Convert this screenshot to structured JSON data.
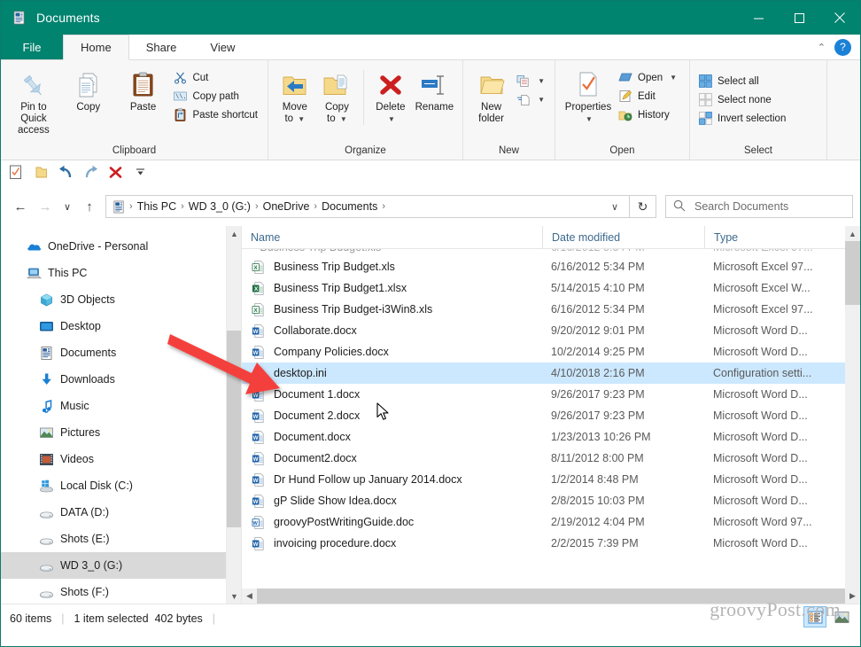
{
  "window": {
    "title": "Documents",
    "title_icon": "documents-folder-icon",
    "minimize_label": "─",
    "maximize_label": "☐",
    "close_label": "✕"
  },
  "tabs": {
    "file_label": "File",
    "items": [
      {
        "label": "Home",
        "active": true
      },
      {
        "label": "Share",
        "active": false
      },
      {
        "label": "View",
        "active": false
      }
    ],
    "collapse_label": "⌃",
    "help_label": "?"
  },
  "ribbon": {
    "groups": [
      {
        "label": "Clipboard",
        "big_buttons": [
          {
            "label": "Pin to Quick\naccess",
            "icon": "pin-icon",
            "line1": "Pin to Quick",
            "line2": "access"
          },
          {
            "label": "Copy",
            "icon": "copy-icon",
            "line1": "Copy",
            "line2": ""
          },
          {
            "label": "Paste",
            "icon": "paste-icon",
            "line1": "Paste",
            "line2": ""
          }
        ],
        "small_buttons": [
          {
            "label": "Cut",
            "icon": "scissors-icon"
          },
          {
            "label": "Copy path",
            "icon": "copy-path-icon"
          },
          {
            "label": "Paste shortcut",
            "icon": "paste-shortcut-icon"
          }
        ]
      },
      {
        "label": "Organize",
        "big_buttons": [
          {
            "line1": "Move",
            "line2": "to",
            "icon": "move-to-icon",
            "dropdown": true
          },
          {
            "line1": "Copy",
            "line2": "to",
            "icon": "copy-to-icon",
            "dropdown": true
          },
          {
            "line1": "Delete",
            "line2": "",
            "icon": "delete-icon",
            "dropdown": true
          },
          {
            "line1": "Rename",
            "line2": "",
            "icon": "rename-icon",
            "dropdown": false
          }
        ],
        "small_buttons": []
      },
      {
        "label": "New",
        "big_buttons": [
          {
            "line1": "New",
            "line2": "folder",
            "icon": "new-folder-icon",
            "dropdown": false
          }
        ],
        "small_buttons": [
          {
            "label": "",
            "icon": "new-item-icon",
            "dropdown": true
          },
          {
            "label": "",
            "icon": "easy-access-icon",
            "dropdown": true
          }
        ]
      },
      {
        "label": "Open",
        "big_buttons": [
          {
            "line1": "Properties",
            "line2": "",
            "icon": "properties-icon",
            "dropdown": true
          }
        ],
        "small_buttons": [
          {
            "label": "Open",
            "icon": "open-icon",
            "dropdown": true
          },
          {
            "label": "Edit",
            "icon": "edit-icon",
            "dropdown": false
          },
          {
            "label": "History",
            "icon": "history-icon",
            "dropdown": false
          }
        ]
      },
      {
        "label": "Select",
        "big_buttons": [],
        "small_buttons": [
          {
            "label": "Select all",
            "icon": "select-all-icon"
          },
          {
            "label": "Select none",
            "icon": "select-none-icon"
          },
          {
            "label": "Invert selection",
            "icon": "invert-selection-icon"
          }
        ]
      }
    ]
  },
  "quick_access": {
    "items": [
      {
        "name": "properties-qat-icon"
      },
      {
        "name": "new-folder-qat-icon"
      },
      {
        "name": "undo-qat-icon"
      },
      {
        "name": "redo-qat-icon"
      },
      {
        "name": "delete-qat-icon"
      },
      {
        "name": "customize-qat-icon"
      }
    ]
  },
  "navigation": {
    "back_label": "←",
    "forward_label": "→",
    "recent_label": "∨",
    "up_label": "↑",
    "breadcrumb": [
      "This PC",
      "WD 3_0 (G:)",
      "OneDrive",
      "Documents"
    ],
    "breadcrumb_separator": "›",
    "dropdown_label": "∨",
    "refresh_label": "↻"
  },
  "search": {
    "placeholder": "Search Documents",
    "value": "",
    "icon": "search-icon"
  },
  "sidebar": {
    "items": [
      {
        "label": "OneDrive - Personal",
        "icon": "onedrive-icon",
        "level": 0,
        "selected": false
      },
      {
        "label": "This PC",
        "icon": "this-pc-icon",
        "level": 0,
        "selected": false
      },
      {
        "label": "3D Objects",
        "icon": "3d-objects-icon",
        "level": 1,
        "selected": false
      },
      {
        "label": "Desktop",
        "icon": "desktop-icon",
        "level": 1,
        "selected": false
      },
      {
        "label": "Documents",
        "icon": "documents-icon",
        "level": 1,
        "selected": false
      },
      {
        "label": "Downloads",
        "icon": "downloads-icon",
        "level": 1,
        "selected": false
      },
      {
        "label": "Music",
        "icon": "music-icon",
        "level": 1,
        "selected": false
      },
      {
        "label": "Pictures",
        "icon": "pictures-icon",
        "level": 1,
        "selected": false
      },
      {
        "label": "Videos",
        "icon": "videos-icon",
        "level": 1,
        "selected": false
      },
      {
        "label": "Local Disk (C:)",
        "icon": "local-disk-icon",
        "level": 1,
        "selected": false
      },
      {
        "label": "DATA (D:)",
        "icon": "drive-icon",
        "level": 1,
        "selected": false
      },
      {
        "label": "Shots (E:)",
        "icon": "drive-icon",
        "level": 1,
        "selected": false
      },
      {
        "label": "WD 3_0 (G:)",
        "icon": "drive-icon",
        "level": 1,
        "selected": true
      },
      {
        "label": "Shots (F:)",
        "icon": "drive-icon",
        "level": 1,
        "selected": false
      }
    ]
  },
  "file_list": {
    "columns": [
      {
        "label": "Name",
        "sorted": true,
        "sort_direction": "ascending"
      },
      {
        "label": "Date modified",
        "sorted": false
      },
      {
        "label": "Type",
        "sorted": false
      }
    ],
    "rows": [
      {
        "name": "Business Trip Budget.xls",
        "date": "6/16/2012 5:34 PM",
        "type": "Microsoft Excel 97...",
        "icon": "excel-97-icon",
        "selected": false
      },
      {
        "name": "Business Trip Budget1.xlsx",
        "date": "5/14/2015 4:10 PM",
        "type": "Microsoft Excel W...",
        "icon": "excel-icon",
        "selected": false
      },
      {
        "name": "Business Trip Budget-i3Win8.xls",
        "date": "6/16/2012 5:34 PM",
        "type": "Microsoft Excel 97...",
        "icon": "excel-97-icon",
        "selected": false
      },
      {
        "name": "Collaborate.docx",
        "date": "9/20/2012 9:01 PM",
        "type": "Microsoft Word D...",
        "icon": "word-icon",
        "selected": false
      },
      {
        "name": "Company Policies.docx",
        "date": "10/2/2014 9:25 PM",
        "type": "Microsoft Word D...",
        "icon": "word-icon",
        "selected": false
      },
      {
        "name": "desktop.ini",
        "date": "4/10/2018 2:16 PM",
        "type": "Configuration setti...",
        "icon": "ini-config-icon",
        "selected": true
      },
      {
        "name": "Document 1.docx",
        "date": "9/26/2017 9:23 PM",
        "type": "Microsoft Word D...",
        "icon": "word-icon",
        "selected": false
      },
      {
        "name": "Document 2.docx",
        "date": "9/26/2017 9:23 PM",
        "type": "Microsoft Word D...",
        "icon": "word-icon",
        "selected": false
      },
      {
        "name": "Document.docx",
        "date": "1/23/2013 10:26 PM",
        "type": "Microsoft Word D...",
        "icon": "word-icon",
        "selected": false
      },
      {
        "name": "Document2.docx",
        "date": "8/11/2012 8:00 PM",
        "type": "Microsoft Word D...",
        "icon": "word-icon",
        "selected": false
      },
      {
        "name": "Dr Hund Follow up January 2014.docx",
        "date": "1/2/2014 8:48 PM",
        "type": "Microsoft Word D...",
        "icon": "word-icon",
        "selected": false
      },
      {
        "name": "gP Slide Show Idea.docx",
        "date": "2/8/2015 10:03 PM",
        "type": "Microsoft Word D...",
        "icon": "word-icon",
        "selected": false
      },
      {
        "name": "groovyPostWritingGuide.doc",
        "date": "2/19/2012 4:04 PM",
        "type": "Microsoft Word 97...",
        "icon": "word-97-icon",
        "selected": false
      },
      {
        "name": "invoicing procedure.docx",
        "date": "2/2/2015 7:39 PM",
        "type": "Microsoft Word D...",
        "icon": "word-icon",
        "selected": false
      }
    ]
  },
  "status": {
    "item_count": "60 items",
    "selection": "1 item selected",
    "size": "402 bytes",
    "view_details_icon": "details-view-icon",
    "view_thumbnails_icon": "large-icons-view-icon"
  },
  "watermark": {
    "text": "groovyPost.com"
  },
  "annotation": {
    "arrow_color": "#f4413c",
    "points_to": "desktop.ini"
  },
  "colors": {
    "title_bar": "#00836f",
    "accent": "#0078d7",
    "selection": "#cce8ff",
    "ribbon_bg": "#f7f7f7"
  }
}
